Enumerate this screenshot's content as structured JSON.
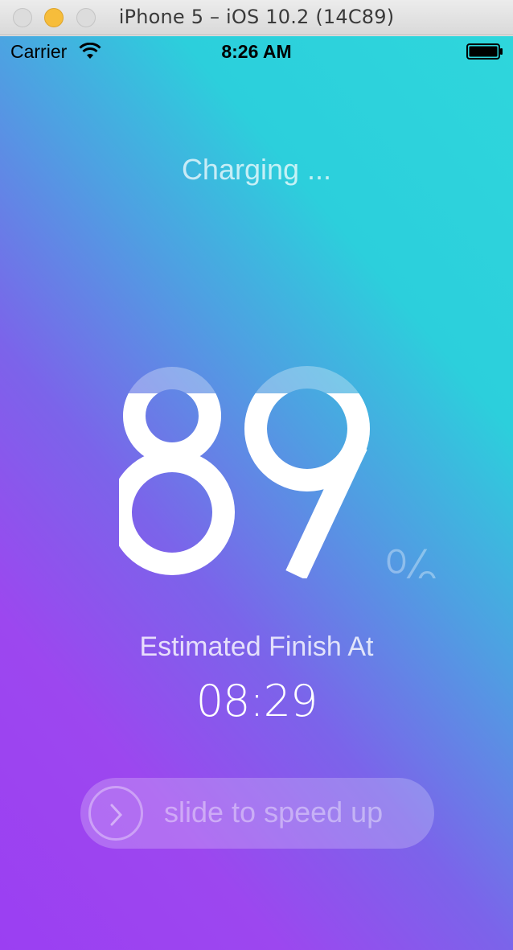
{
  "window": {
    "title": "iPhone 5 – iOS 10.2 (14C89)"
  },
  "statusbar": {
    "carrier": "Carrier",
    "time": "8:26 AM"
  },
  "charging": {
    "status": "Charging ...",
    "percent_digit_1": "8",
    "percent_digit_2": "9",
    "percent_symbol": "%",
    "estimated_label": "Estimated Finish At",
    "finish_time": "08:29"
  },
  "slider": {
    "label": "slide to speed up"
  },
  "colors": {
    "gradient_purple": "#9b3ff2",
    "gradient_cyan": "#2ed6dc",
    "text_white": "#ffffff"
  },
  "icons": [
    "close-icon",
    "minimize-icon",
    "zoom-icon",
    "wifi-icon",
    "battery-icon",
    "chevron-right-icon"
  ]
}
